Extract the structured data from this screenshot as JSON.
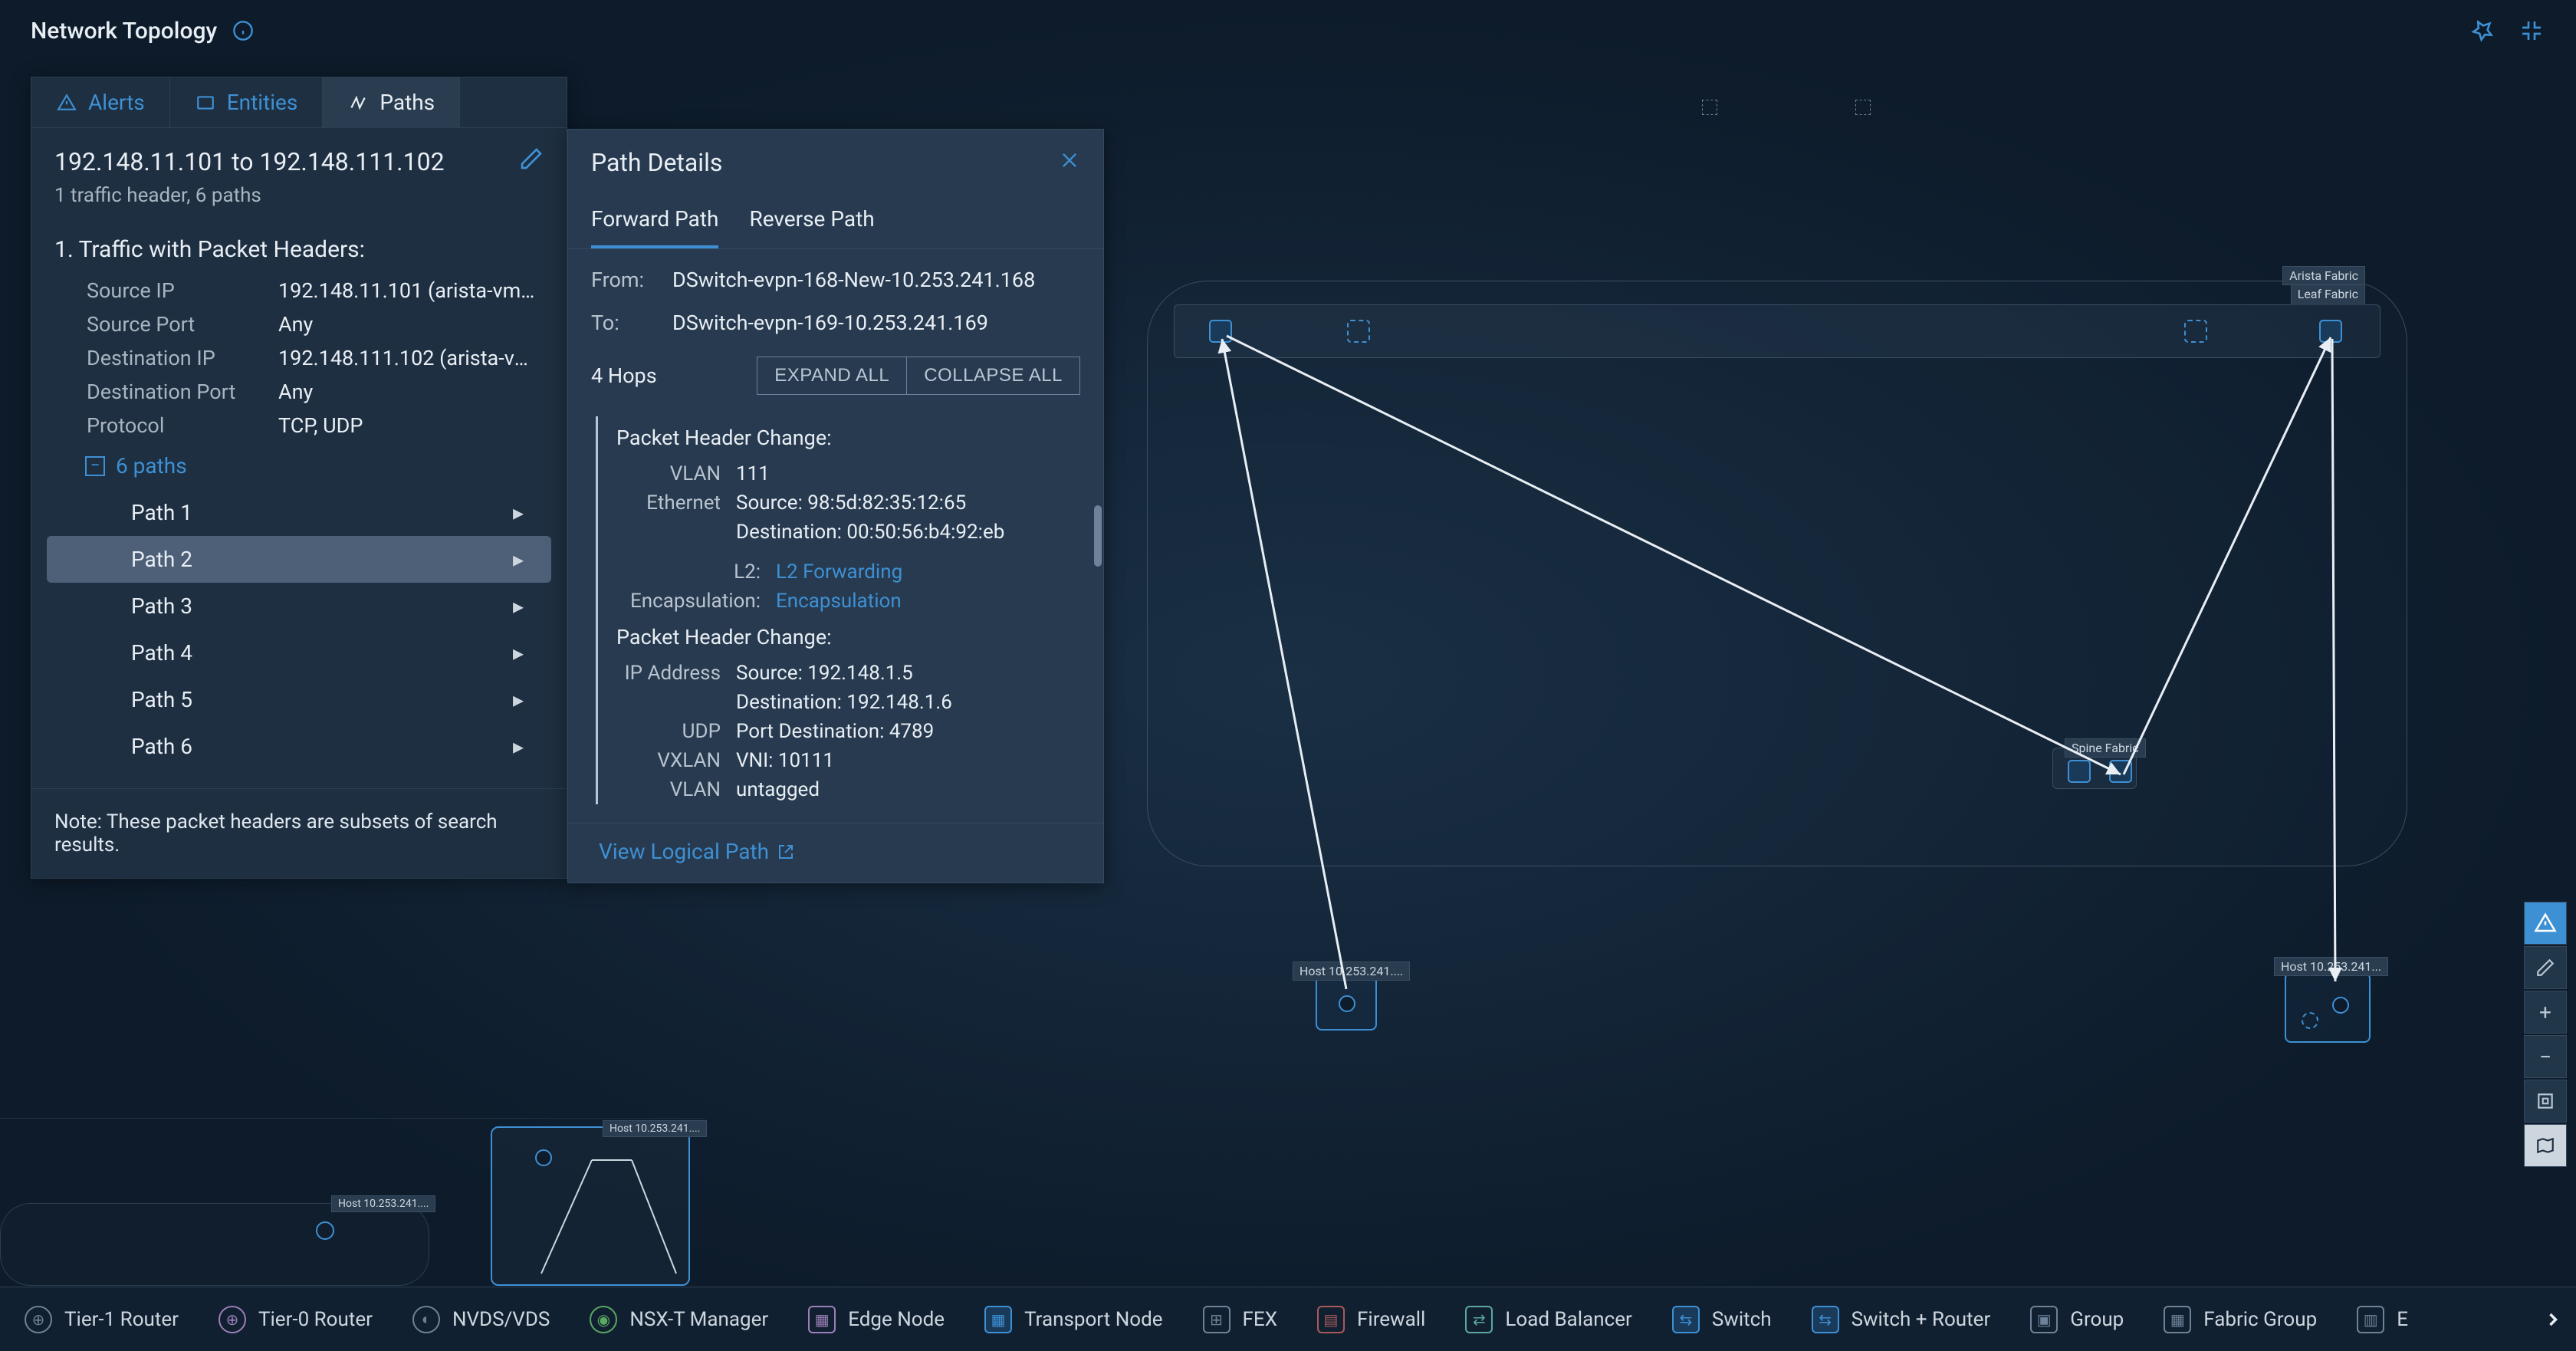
{
  "header": {
    "title": "Network Topology"
  },
  "tabs": {
    "alerts": "Alerts",
    "entities": "Entities",
    "paths": "Paths"
  },
  "query": {
    "text": "192.148.11.101 to 192.148.111.102",
    "subline": "1 traffic header, 6 paths"
  },
  "traffic": {
    "title": "1. Traffic with Packet Headers:",
    "rows": [
      {
        "k": "Source IP",
        "v": "192.148.11.101 (arista-vm1-..."
      },
      {
        "k": "Source Port",
        "v": "Any"
      },
      {
        "k": "Destination IP",
        "v": "192.148.111.102 (arista-vm..."
      },
      {
        "k": "Destination Port",
        "v": "Any"
      },
      {
        "k": "Protocol",
        "v": "TCP, UDP"
      }
    ],
    "paths_label": "6 paths",
    "paths": [
      {
        "label": "Path 1"
      },
      {
        "label": "Path 2"
      },
      {
        "label": "Path 3"
      },
      {
        "label": "Path 4"
      },
      {
        "label": "Path 5"
      },
      {
        "label": "Path 6"
      }
    ],
    "note": "Note: These packet headers are subsets of search results."
  },
  "details": {
    "title": "Path Details",
    "tabs": {
      "forward": "Forward Path",
      "reverse": "Reverse Path"
    },
    "from_label": "From:",
    "from": "DSwitch-evpn-168-New-10.253.241.168",
    "to_label": "To:",
    "to": "DSwitch-evpn-169-10.253.241.169",
    "hops": "4 Hops",
    "expand": "EXPAND ALL",
    "collapse": "COLLAPSE ALL",
    "phc1": "Packet Header Change:",
    "vlan_k": "VLAN",
    "vlan_v": "111",
    "eth_k": "Ethernet",
    "eth_src": "Source: 98:5d:82:35:12:65",
    "eth_dst": "Destination: 00:50:56:b4:92:eb",
    "l2_k": "L2:",
    "l2_v": "L2 Forwarding",
    "encap_k": "Encapsulation:",
    "encap_v": "Encapsulation",
    "phc2": "Packet Header Change:",
    "ip_k": "IP Address",
    "ip_src": "Source: 192.148.1.5",
    "ip_dst": "Destination: 192.148.1.6",
    "udp_k": "UDP",
    "udp_v": "Port Destination: 4789",
    "vxlan_k": "VXLAN",
    "vxlan_v": "VNI: 10111",
    "vlan2_k": "VLAN",
    "vlan2_v": "untagged",
    "view_logical": "View Logical Path"
  },
  "topo_labels": {
    "arista": "Arista Fabric",
    "leaf": "Leaf Fabric",
    "spine": "Spine Fabric",
    "host168": "Host 10.253.241....",
    "host169": "Host 10.253.241...",
    "mm_host168": "Host 10.253.241....",
    "mm_host169": "Host 10.253.241...."
  },
  "legend": [
    {
      "label": "Tier-1 Router",
      "cls": "circle"
    },
    {
      "label": "Tier-0 Router",
      "cls": "circle purple"
    },
    {
      "label": "NVDS/VDS",
      "cls": "circle"
    },
    {
      "label": "NSX-T Manager",
      "cls": "circle green"
    },
    {
      "label": "Edge Node",
      "cls": "purple"
    },
    {
      "label": "Transport Node",
      "cls": "blue"
    },
    {
      "label": "FEX",
      "cls": ""
    },
    {
      "label": "Firewall",
      "cls": "red"
    },
    {
      "label": "Load Balancer",
      "cls": "teal"
    },
    {
      "label": "Switch",
      "cls": "blue"
    },
    {
      "label": "Switch + Router",
      "cls": "blue"
    },
    {
      "label": "Group",
      "cls": ""
    },
    {
      "label": "Fabric Group",
      "cls": ""
    },
    {
      "label": "E",
      "cls": ""
    }
  ]
}
